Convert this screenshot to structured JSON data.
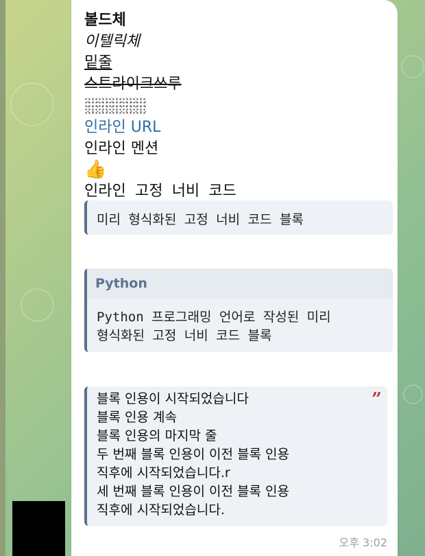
{
  "message": {
    "bold": "볼드체",
    "italic": "이텔릭체",
    "underline": "밑줄",
    "strikethrough": "스트라이크쓰루",
    "inline_url": "인라인 URL",
    "inline_mention": "인라인 멘션",
    "emoji": "👍",
    "inline_code": "인라인 고정 너비 코드",
    "pre_block": "미리 형식화된 고정 너비 코드 블록",
    "code_block": {
      "language": "Python",
      "lines": [
        "Python 프로그래밍 언어로 작성된 미리",
        "형식화된 고정 너비 코드 블록"
      ]
    },
    "blockquote": {
      "lines": [
        "블록 인용이 시작되었습니다",
        "블록 인용 계속",
        "블록 인용의 마지막 줄",
        "두 번째 블록 인용이 이전 블록 인용",
        "직후에 시작되었습니다.r",
        "세 번째 블록 인용이 이전 블록 인용",
        "직후에 시작되었습니다."
      ],
      "quote_icon": "quote-icon"
    },
    "time": "오후 3:02"
  },
  "colors": {
    "link": "#2f6ea5",
    "quote_mark": "#c43a3a",
    "quote_bar": "#58708a"
  }
}
